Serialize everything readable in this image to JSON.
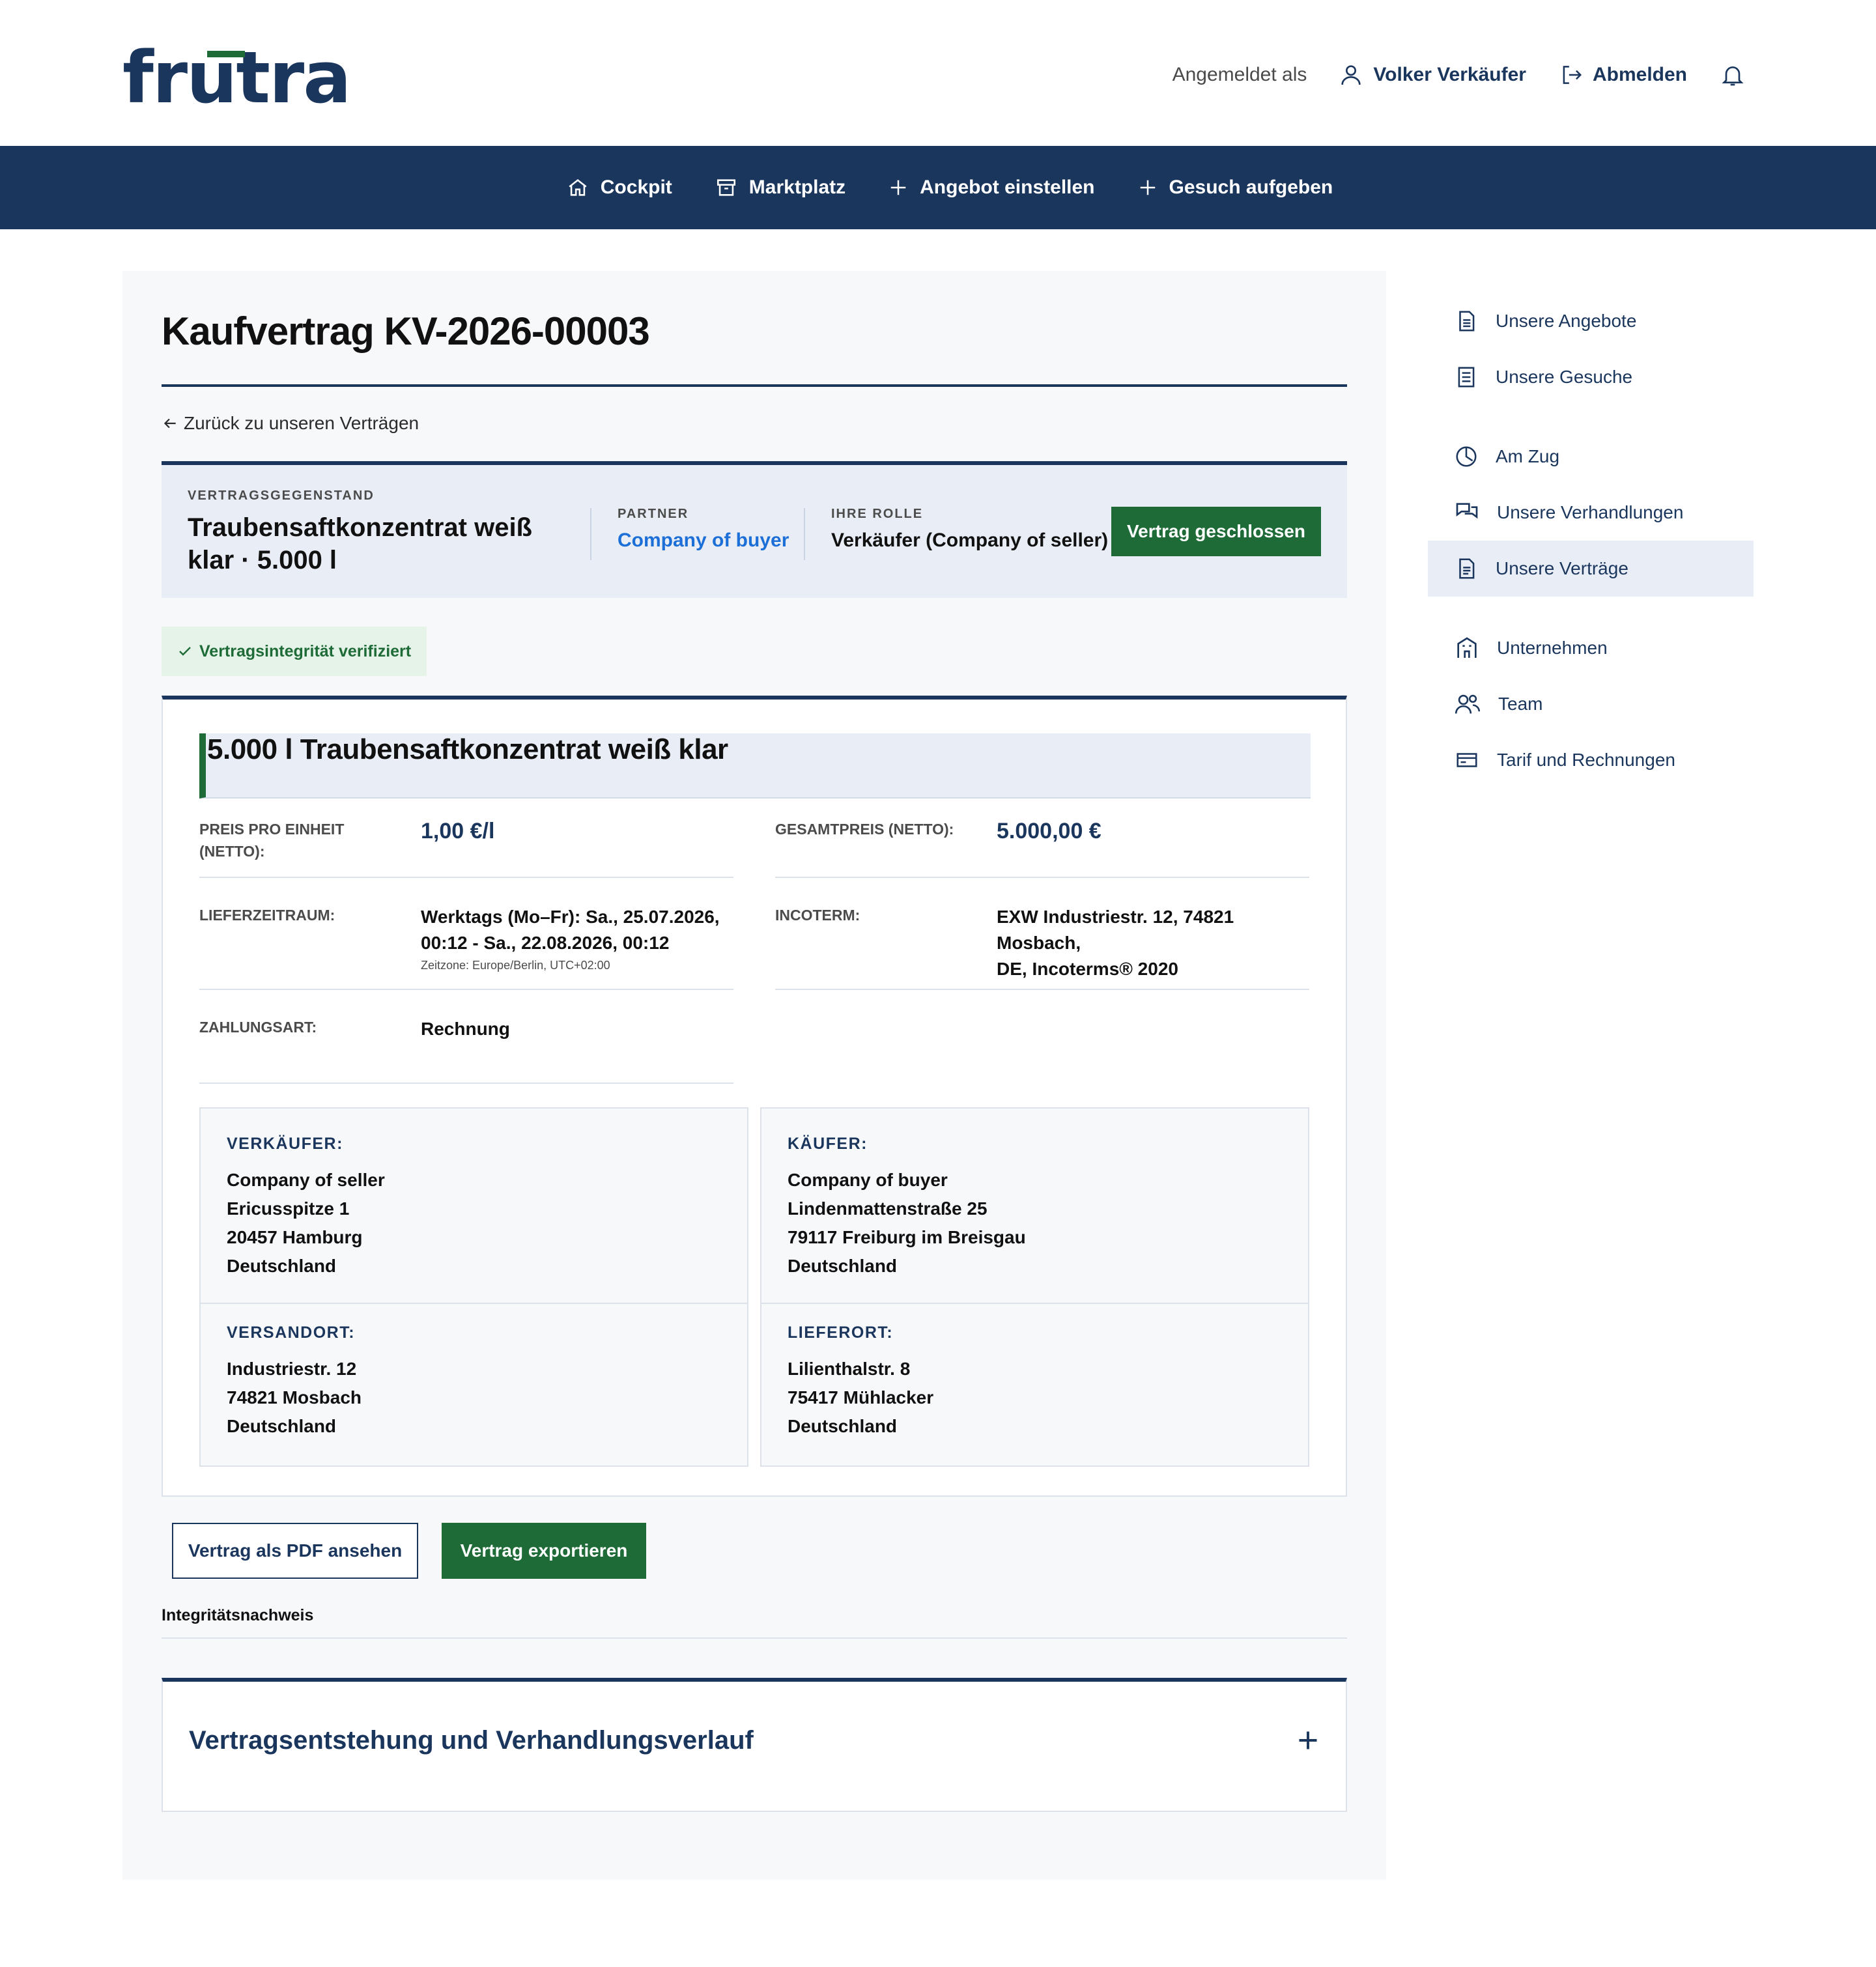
{
  "brand": {
    "logo_text": "frutra",
    "primary_color": "#1b365d",
    "accent_color": "#1e6b37"
  },
  "header": {
    "logged_in_label": "Angemeldet als",
    "user_name": "Volker Verkäufer",
    "logout_label": "Abmelden",
    "icons": [
      "user-icon",
      "logout-icon",
      "bell-icon"
    ]
  },
  "topnav": {
    "items": [
      {
        "label": "Cockpit",
        "icon": "home-icon"
      },
      {
        "label": "Marktplatz",
        "icon": "archive-box-icon"
      },
      {
        "label": "Angebot einstellen",
        "icon": "plus-icon"
      },
      {
        "label": "Gesuch aufgeben",
        "icon": "plus-icon"
      }
    ]
  },
  "page": {
    "title": "Kaufvertrag KV-2026-00003",
    "back_link": "Zurück zu unseren Verträgen"
  },
  "summary": {
    "subject_label": "VERTRAGSGEGENSTAND",
    "subject_line1": "Traubensaftkonzentrat weiß",
    "subject_line2": "klar · 5.000 l",
    "partner_label": "PARTNER",
    "partner_value": "Company of buyer",
    "role_label": "IHRE ROLLE",
    "role_value": "Verkäufer (Company of seller)",
    "status_label": "Vertrag geschlossen"
  },
  "verification": {
    "label": "Vertragsintegrität verifiziert",
    "icon": "check-icon"
  },
  "contract": {
    "product_title": "5.000 l Traubensaftkonzentrat weiß klar",
    "unit_price_label_1": "PREIS PRO EINHEIT",
    "unit_price_label_2": "(NETTO):",
    "unit_price_value": "1,00 €/l",
    "total_price_label": "GESAMTPREIS (NETTO):",
    "total_price_value": "5.000,00 €",
    "delivery_period_label": "LIEFERZEITRAUM:",
    "delivery_period_line1": "Werktags (Mo–Fr): Sa., 25.07.2026,",
    "delivery_period_line2": "00:12 - Sa., 22.08.2026, 00:12",
    "delivery_period_tz": "Zeitzone: Europe/Berlin, UTC+02:00",
    "incoterm_label": "INCOTERM:",
    "incoterm_line1": "EXW Industriestr. 12, 74821 Mosbach,",
    "incoterm_line2": "DE, Incoterms® 2020",
    "payment_label": "ZAHLUNGSART:",
    "payment_value": "Rechnung"
  },
  "addresses": {
    "seller": {
      "label": "VERKÄUFER:",
      "lines": [
        "Company of seller",
        "Ericusspitze 1",
        "20457 Hamburg",
        "Deutschland"
      ]
    },
    "buyer": {
      "label": "KÄUFER:",
      "lines": [
        "Company of buyer",
        "Lindenmattenstraße 25",
        "79117 Freiburg im Breisgau",
        "Deutschland"
      ]
    },
    "ship_from": {
      "label": "VERSANDORT:",
      "lines": [
        "Industriestr. 12",
        "74821 Mosbach",
        "Deutschland"
      ]
    },
    "ship_to": {
      "label": "LIEFERORT:",
      "lines": [
        "Lilienthalstr. 8",
        "75417 Mühlacker",
        "Deutschland"
      ]
    }
  },
  "actions": {
    "view_pdf": "Vertrag als PDF ansehen",
    "export": "Vertrag exportieren",
    "integrity_proof": "Integritätsnachweis"
  },
  "accordion": {
    "title": "Vertragsentstehung und Verhandlungsverlauf",
    "icon": "plus-icon"
  },
  "sidenav": {
    "items": [
      {
        "label": "Unsere Angebote",
        "icon": "document-icon"
      },
      {
        "label": "Unsere Gesuche",
        "icon": "list-document-icon"
      },
      {
        "label": "Am Zug",
        "icon": "clock-icon"
      },
      {
        "label": "Unsere Verhandlungen",
        "icon": "chat-bubbles-icon"
      },
      {
        "label": "Unsere Verträge",
        "icon": "contract-document-icon",
        "active": true
      },
      {
        "label": "Unternehmen",
        "icon": "building-icon"
      },
      {
        "label": "Team",
        "icon": "team-icon"
      },
      {
        "label": "Tarif und Rechnungen",
        "icon": "credit-card-icon"
      }
    ]
  }
}
